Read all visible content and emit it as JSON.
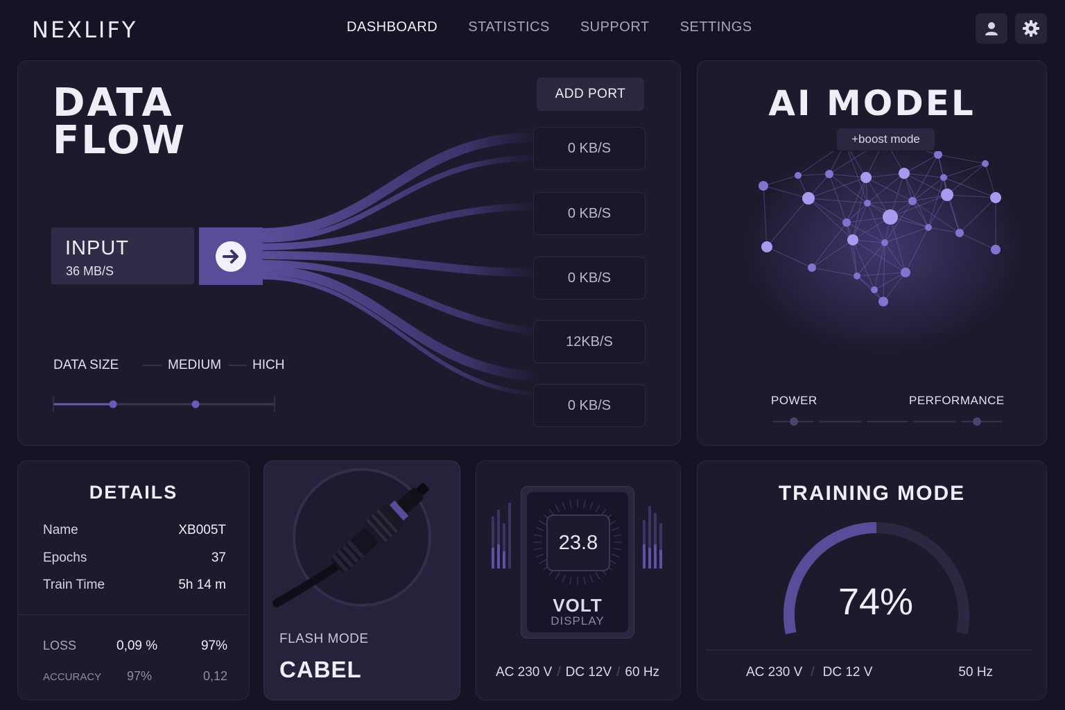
{
  "app": {
    "logo": "NEXLIFY"
  },
  "nav": [
    {
      "label": "DASHBOARD",
      "active": true
    },
    {
      "label": "STATISTICS",
      "active": false
    },
    {
      "label": "SUPPORT",
      "active": false
    },
    {
      "label": "SETTINGS",
      "active": false
    }
  ],
  "header_icons": [
    "user-icon",
    "gear-icon"
  ],
  "data_flow": {
    "title_line1": "DATA",
    "title_line2": "FLOW",
    "add_port": "ADD PORT",
    "input_label": "INPUT",
    "input_rate": "36 MB/S",
    "input_button_icon": "arrow-right-icon",
    "ports": [
      "0 KB/S",
      "0 KB/S",
      "0 KB/S",
      "12KB/S",
      "0 KB/S"
    ],
    "data_size": {
      "label": "DATA SIZE",
      "medium": "MEDIUM",
      "high": "HICH",
      "level": 0.27
    }
  },
  "ai_model": {
    "title": "AI MODEL",
    "boost": "+boost mode",
    "power_label": "POWER",
    "performance_label": "PERFORMANCE"
  },
  "details": {
    "title": "DETAILS",
    "rows": [
      {
        "label": "Name",
        "value": "XB005T"
      },
      {
        "label": "Epochs",
        "value": "37"
      },
      {
        "label": "Train Time",
        "value": "5h 14 m"
      }
    ],
    "metrics": [
      {
        "label": "LOSS",
        "v1": "0,09 %",
        "v2": "97%"
      },
      {
        "label": "ACCURACY",
        "v1": "97%",
        "v2": "0,12"
      }
    ]
  },
  "cable": {
    "mode": "FLASH MODE",
    "name": "CABEL"
  },
  "volt": {
    "value": "23.8",
    "label": "VOLT",
    "sub": "DISPLAY",
    "ac": "AC 230 V",
    "dc": "DC 12V",
    "hz": "60 Hz"
  },
  "training": {
    "title": "TRAINING MODE",
    "percent": "74%",
    "progress": 0.74,
    "ac": "AC 230 V",
    "dc": "DC 12 V",
    "hz": "50 Hz"
  },
  "colors": {
    "accent": "#5a4c98",
    "panel": "#1d1a2e",
    "background": "#161424"
  }
}
